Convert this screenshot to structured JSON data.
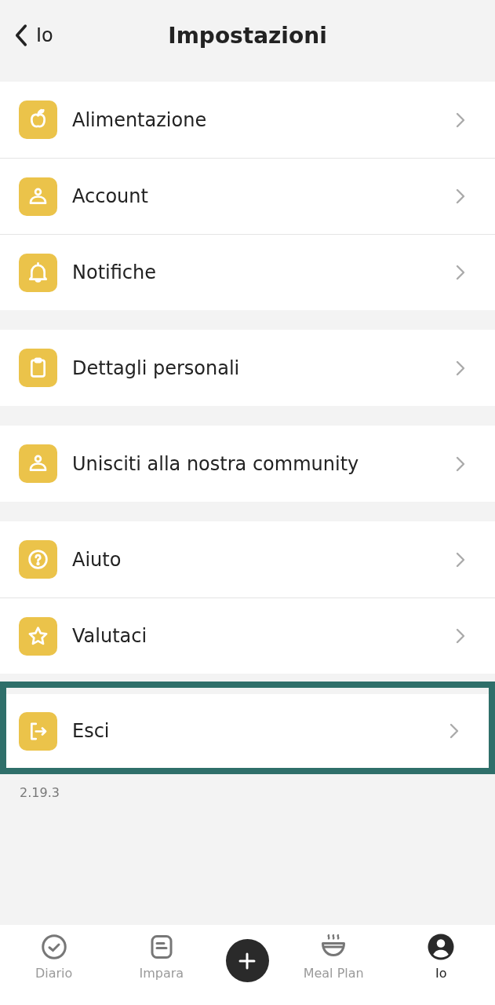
{
  "header": {
    "back_label": "Io",
    "title": "Impostazioni"
  },
  "groups": [
    {
      "highlighted": false,
      "items": [
        {
          "kind": "apple",
          "label": "Alimentazione"
        },
        {
          "kind": "person",
          "label": "Account"
        },
        {
          "kind": "bell",
          "label": "Notifiche"
        }
      ]
    },
    {
      "highlighted": false,
      "items": [
        {
          "kind": "clipboard",
          "label": "Dettagli personali"
        }
      ]
    },
    {
      "highlighted": false,
      "items": [
        {
          "kind": "person",
          "label": "Unisciti alla nostra community"
        }
      ]
    },
    {
      "highlighted": false,
      "items": [
        {
          "kind": "help",
          "label": "Aiuto"
        },
        {
          "kind": "star",
          "label": "Valutaci"
        }
      ]
    },
    {
      "highlighted": true,
      "items": [
        {
          "kind": "logout",
          "label": "Esci"
        }
      ]
    }
  ],
  "version": "2.19.3",
  "tab_bar": [
    {
      "kind": "check",
      "label": "Diario",
      "selected": false
    },
    {
      "kind": "note",
      "label": "Impara",
      "selected": false
    },
    {
      "kind": "add",
      "selected": false
    },
    {
      "kind": "bowl",
      "label": "Meal Plan",
      "selected": false
    },
    {
      "kind": "profile",
      "label": "Io",
      "selected": true
    }
  ]
}
